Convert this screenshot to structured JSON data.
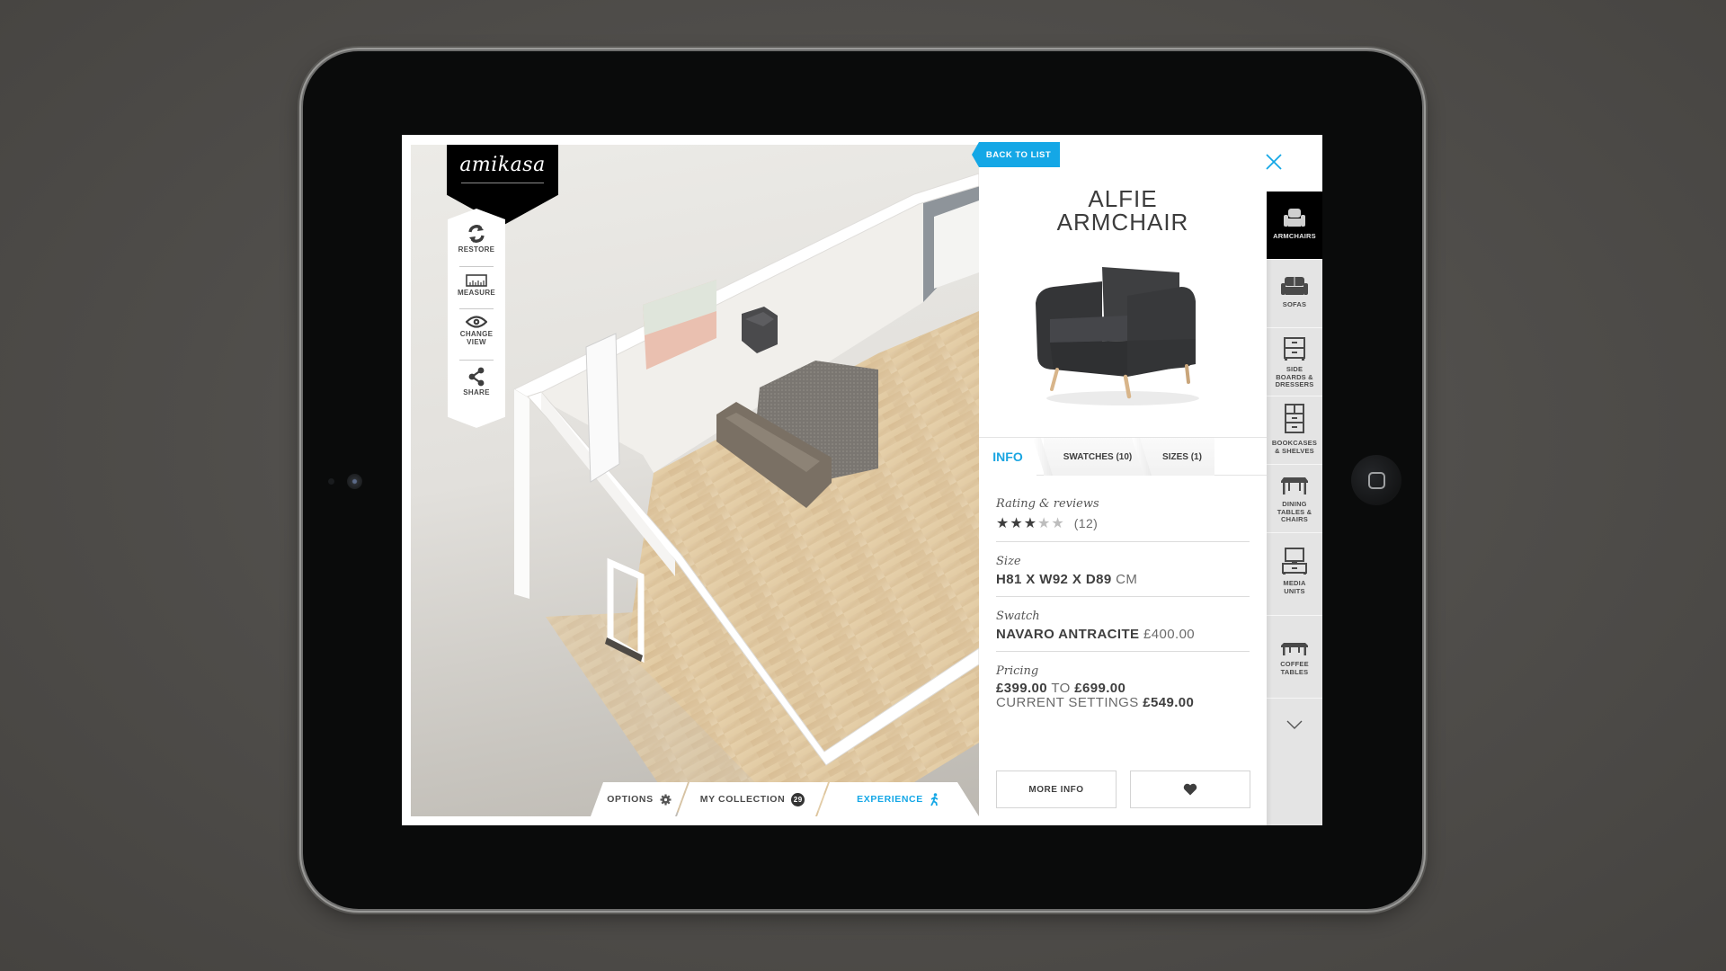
{
  "app": {
    "brand": "amikasa",
    "accent_color": "#14a7e6"
  },
  "tools": [
    {
      "label": "RESTORE",
      "icon": "restore-icon"
    },
    {
      "label": "MEASURE",
      "icon": "ruler-icon"
    },
    {
      "label": "CHANGE VIEW",
      "icon": "eye-icon"
    },
    {
      "label": "SHARE",
      "icon": "share-icon"
    }
  ],
  "bottom_bar": {
    "options_label": "OPTIONS",
    "collection_label": "MY COLLECTION",
    "collection_count": "29",
    "experience_label": "EXPERIENCE"
  },
  "detail": {
    "back_label": "BACK TO LIST",
    "title_line1": "ALFIE",
    "title_line2": "ARMCHAIR",
    "tabs": [
      {
        "label": "INFO",
        "active": true
      },
      {
        "label": "SWATCHES (10)",
        "active": false
      },
      {
        "label": "SIZES (1)",
        "active": false
      }
    ],
    "rating": {
      "label": "Rating & reviews",
      "stars_filled": 3,
      "stars_total": 5,
      "count": "(12)"
    },
    "size": {
      "label": "Size",
      "value": "H81 X W92 X D89",
      "unit": "CM"
    },
    "swatch": {
      "label": "Swatch",
      "name": "NAVARO ANTRACITE",
      "price": "£400.00"
    },
    "pricing": {
      "label": "Pricing",
      "min": "£399.00",
      "to": "TO",
      "max": "£699.00",
      "current_label": "CURRENT SETTINGS",
      "current": "£549.00"
    },
    "more_info_label": "MORE INFO",
    "favorite_icon": "heart-icon"
  },
  "categories": [
    {
      "label": "ARMCHAIRS",
      "active": true
    },
    {
      "label": "SOFAS",
      "active": false
    },
    {
      "label": "SIDE BOARDS & DRESSERS",
      "active": false
    },
    {
      "label": "BOOKCASES & SHELVES",
      "active": false
    },
    {
      "label": "DINING TABLES & CHAIRS",
      "active": false
    },
    {
      "label": "MEDIA UNITS",
      "active": false
    },
    {
      "label": "COFFEE TABLES",
      "active": false
    }
  ]
}
